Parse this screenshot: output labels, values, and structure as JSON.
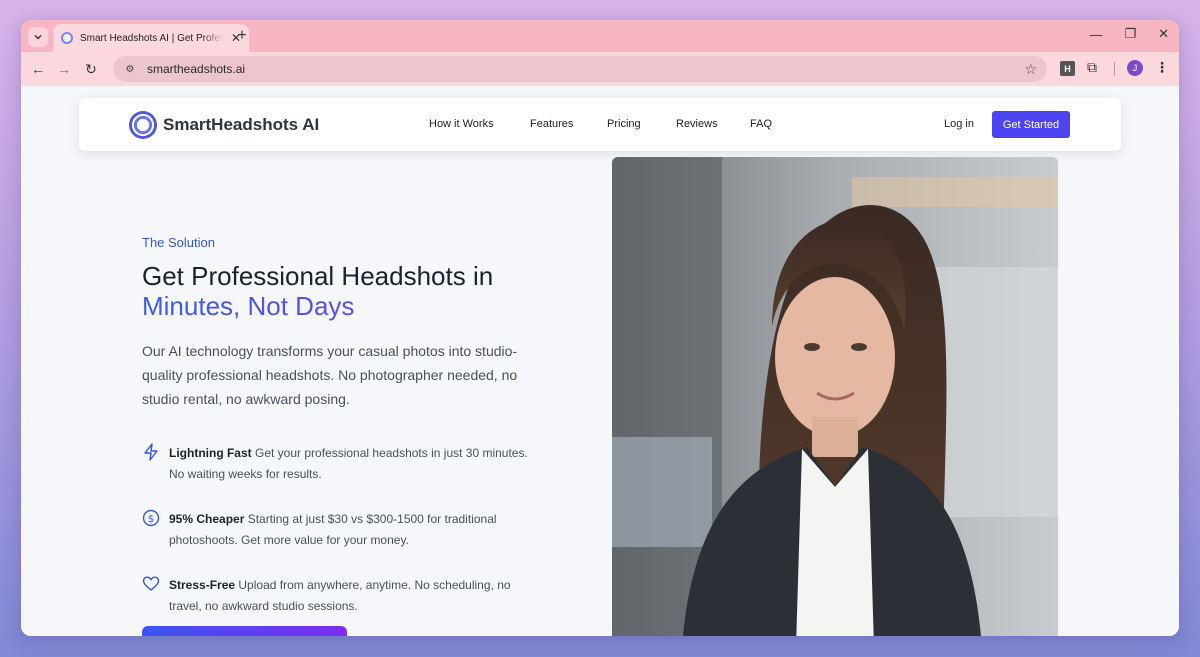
{
  "browser": {
    "tab_title": "Smart Headshots AI | Get Professional Headshots",
    "url": "smartheadshots.ai",
    "profile_initial": "J",
    "extension_label": "H"
  },
  "nav": {
    "brand": "SmartHeadshots AI",
    "links": [
      "How it Works",
      "Features",
      "Pricing",
      "Reviews",
      "FAQ"
    ],
    "login": "Log in",
    "cta": "Get Started"
  },
  "hero": {
    "eyebrow": "The Solution",
    "headline_line1": "Get Professional Headshots in",
    "headline_line2": "Minutes, Not Days",
    "lead": "Our AI technology transforms your casual photos into studio-quality professional headshots. No photographer needed, no studio rental, no awkward posing.",
    "features": [
      {
        "icon": "lightning-icon",
        "title": "Lightning Fast",
        "text": "Get your professional headshots in just 30 minutes. No waiting weeks for results."
      },
      {
        "icon": "dollar-icon",
        "title": "95% Cheaper",
        "text": "Starting at just $30 vs $300-1500 for traditional photoshoots. Get more value for your money."
      },
      {
        "icon": "heart-icon",
        "title": "Stress-Free",
        "text": "Upload from anywhere, anytime. No scheduling, no travel, no awkward studio sessions."
      }
    ]
  },
  "colors": {
    "accent": "#4e43f0",
    "eyebrow": "#3558d6",
    "tabstrip": "#f8b6c2"
  }
}
